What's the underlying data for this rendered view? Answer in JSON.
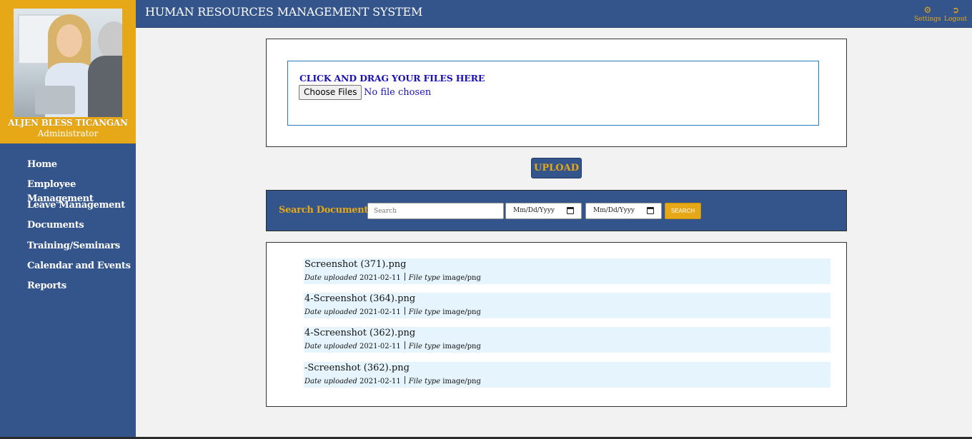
{
  "app": {
    "title": "HUMAN RESOURCES MANAGEMENT SYSTEM"
  },
  "header": {
    "settings_label": "Settings",
    "logout_label": "Logout"
  },
  "user": {
    "name": "ALJEN BLESS TICANGAN",
    "role": "Administrator"
  },
  "sidebar": {
    "items": [
      {
        "label": "Home"
      },
      {
        "label": "Employee Management"
      },
      {
        "label": "Leave Management"
      },
      {
        "label": "Documents"
      },
      {
        "label": "Training/Seminars"
      },
      {
        "label": "Calendar and Events"
      },
      {
        "label": "Reports"
      }
    ]
  },
  "upload": {
    "dropzone_text": "CLICK AND DRAG YOUR FILES HERE",
    "choose_label": "Choose Files",
    "no_file_text": "No file chosen",
    "button_label": "UPLOAD"
  },
  "search": {
    "label": "Search Document",
    "placeholder": "Search",
    "date_from_placeholder": "Mm/Dd/Yyyy",
    "date_to_placeholder": "Mm/Dd/Yyyy",
    "button_label": "SEARCH"
  },
  "documents": {
    "date_label": "Date uploaded",
    "type_label": "File type",
    "items": [
      {
        "name": "Screenshot (371).png",
        "date": "2021-02-11",
        "type": "image/png"
      },
      {
        "name": "4-Screenshot (364).png",
        "date": "2021-02-11",
        "type": "image/png"
      },
      {
        "name": "4-Screenshot (362).png",
        "date": "2021-02-11",
        "type": "image/png"
      },
      {
        "name": "-Screenshot (362).png",
        "date": "2021-02-11",
        "type": "image/png"
      }
    ]
  },
  "colors": {
    "primary": "#34558b",
    "accent": "#e6a817",
    "link": "#1a10b8",
    "row_bg": "#e6f5fd"
  }
}
